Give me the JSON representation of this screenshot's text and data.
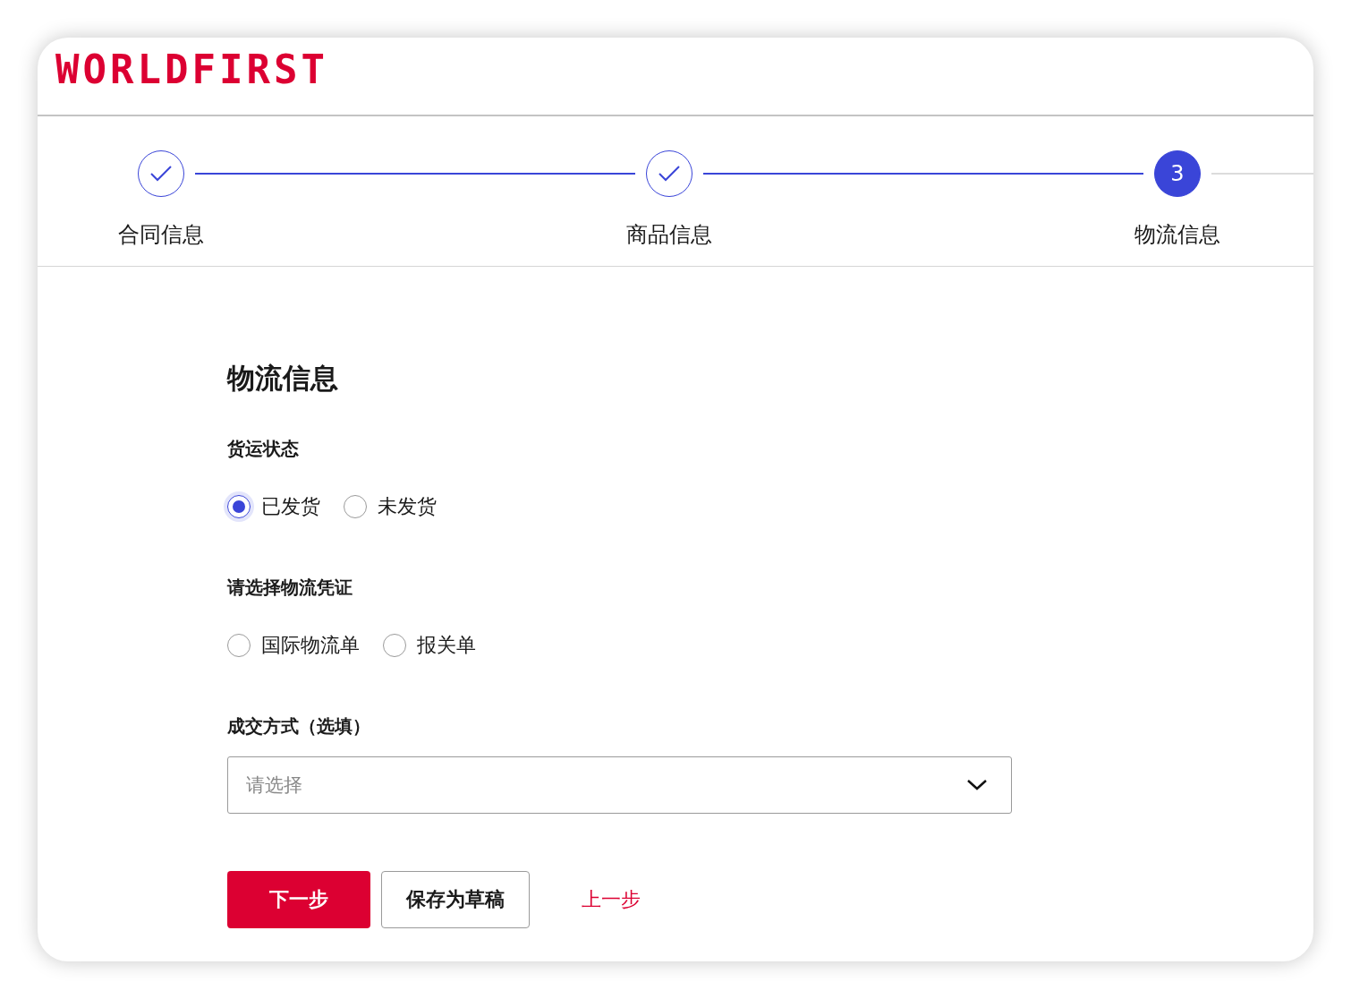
{
  "brand": {
    "logo": "WORLDFIRST"
  },
  "steps": [
    {
      "label": "合同信息",
      "completed": true,
      "selected": false
    },
    {
      "label": "商品信息",
      "completed": true,
      "selected": false
    },
    {
      "label": "物流信息",
      "completed": false,
      "selected": true,
      "number": "3"
    }
  ],
  "form": {
    "title": "物流信息",
    "fields": [
      {
        "kind": "radio",
        "label": "货运状态",
        "options": [
          {
            "label": "已发货",
            "selected": true
          },
          {
            "label": "未发货",
            "selected": false
          }
        ]
      },
      {
        "kind": "radio",
        "label": "请选择物流凭证",
        "options": [
          {
            "label": "国际物流单",
            "selected": false
          },
          {
            "label": "报关单",
            "selected": false
          }
        ]
      },
      {
        "kind": "select",
        "label": "成交方式（选填）",
        "placeholder": "请选择"
      }
    ]
  },
  "buttons": [
    {
      "kind": "primary",
      "label": "下一步"
    },
    {
      "kind": "secondary",
      "label": "保存为草稿"
    },
    {
      "kind": "link",
      "label": "上一步"
    }
  ]
}
